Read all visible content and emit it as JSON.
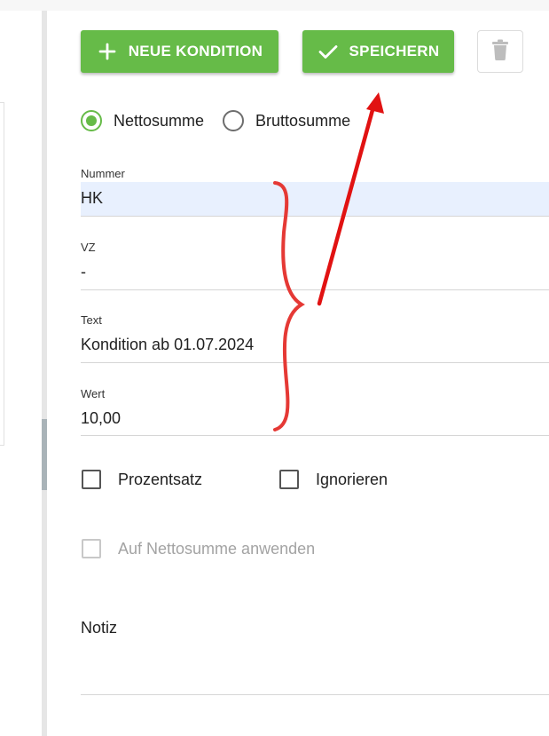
{
  "toolbar": {
    "new_label": "NEUE KONDITION",
    "save_label": "SPEICHERN",
    "new_icon": "plus-icon",
    "save_icon": "check-icon",
    "delete_icon": "trash-icon"
  },
  "sum_type": {
    "options": [
      {
        "label": "Nettosumme",
        "checked": true
      },
      {
        "label": "Bruttosumme",
        "checked": false
      }
    ]
  },
  "fields": {
    "nummer": {
      "label": "Nummer",
      "value": "HK"
    },
    "vz": {
      "label": "VZ",
      "value": "-"
    },
    "text": {
      "label": "Text",
      "value": "Kondition ab 01.07.2024"
    },
    "wert": {
      "label": "Wert",
      "value": "10,00"
    }
  },
  "checkboxes": {
    "prozentsatz": {
      "label": "Prozentsatz",
      "checked": false
    },
    "ignorieren": {
      "label": "Ignorieren",
      "checked": false
    },
    "auf_netto": {
      "label": "Auf Nettosumme anwenden",
      "checked": false,
      "disabled": true
    }
  },
  "notiz": {
    "label": "Notiz",
    "value": ""
  },
  "colors": {
    "accent_green": "#66bb48",
    "annotation_red": "#e53935",
    "field_highlight": "#e8f0fe"
  }
}
